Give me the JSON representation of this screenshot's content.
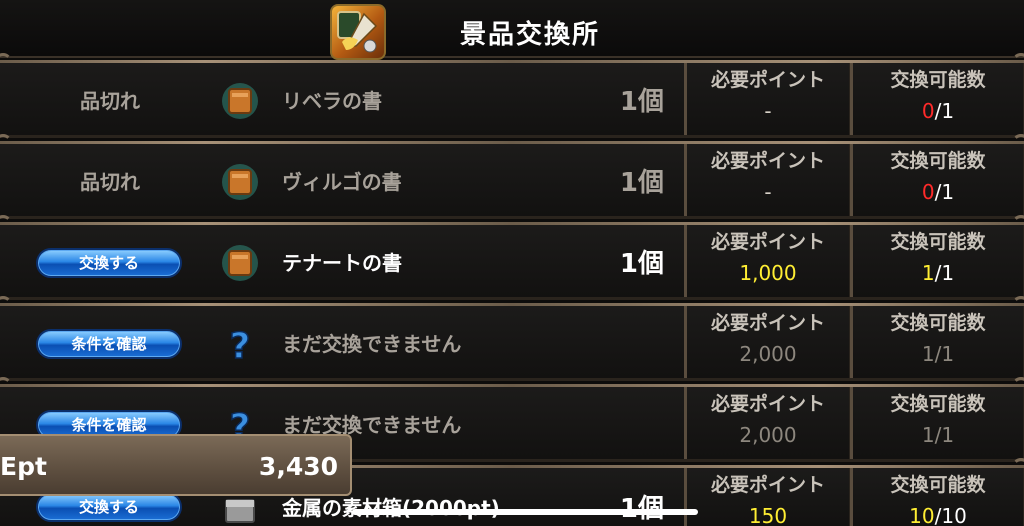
{
  "header": {
    "title": "景品交換所"
  },
  "columns": {
    "points_label": "必要ポイント",
    "count_label": "交換可能数"
  },
  "rows": [
    {
      "status": "品切れ",
      "icon": "book-icon",
      "name": "リベラの書",
      "qty": "1個",
      "points": "-",
      "count_now": "0",
      "count_max": "/1"
    },
    {
      "status": "品切れ",
      "icon": "book-icon",
      "name": "ヴィルゴの書",
      "qty": "1個",
      "points": "-",
      "count_now": "0",
      "count_max": "/1"
    },
    {
      "button": "交換する",
      "icon": "book-icon",
      "name": "テナートの書",
      "qty": "1個",
      "points": "1,000",
      "count_now": "1",
      "count_max": "/1"
    },
    {
      "button": "条件を確認",
      "icon": "question-icon",
      "name": "まだ交換できません",
      "qty": "",
      "points": "2,000",
      "count_now": "1",
      "count_max": "/1"
    },
    {
      "button": "条件を確認",
      "icon": "question-icon",
      "name": "まだ交換できません",
      "qty": "",
      "points": "2,000",
      "count_now": "1",
      "count_max": "/1"
    },
    {
      "button": "交換する",
      "icon": "chest-icon",
      "name": "金属の素材箱(2000pt)",
      "qty": "1個",
      "points": "150",
      "count_now": "10",
      "count_max": "/10"
    }
  ],
  "points_box": {
    "label": "Ept",
    "value": "3,430"
  },
  "colors": {
    "button_blue": "#2a86e6",
    "red": "#ff2a2a",
    "yellow": "#ffee33"
  }
}
